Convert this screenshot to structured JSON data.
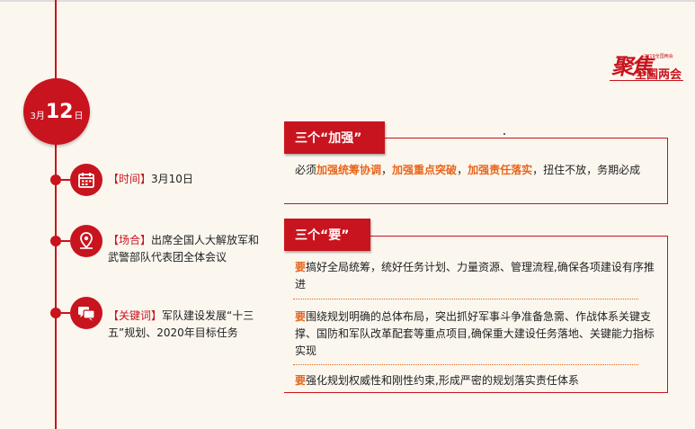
{
  "date": {
    "month": "3月",
    "day": "12",
    "suffix": "日"
  },
  "logo": {
    "big": "聚焦",
    "small": "2019全国两会",
    "year": "2019",
    "sub": "全国两会"
  },
  "info": {
    "time_label": "【时间】",
    "time_value": "3月10日",
    "place_label": "【场合】",
    "place_value": "出席全国人大解放军和武警部队代表团全体会议",
    "keyword_label": "【关键词】",
    "keyword_value": "军队建设发展“十三五”规划、2020年目标任务"
  },
  "section1": {
    "tag": "三个“加强”",
    "prefix": "必须",
    "h1": "加强统筹协调",
    "sep1": "，",
    "h2": "加强重点突破",
    "sep2": "，",
    "h3": "加强责任落实",
    "suffix": "，扭住不放，务期必成"
  },
  "section2": {
    "tag": "三个“要”",
    "items": [
      {
        "yao": "要",
        "text": "搞好全局统筹，统好任务计划、力量资源、管理流程,确保各项建设有序推进"
      },
      {
        "yao": "要",
        "text": "围绕规划明确的总体布局，突出抓好军事斗争准备急需、作战体系关键支撑、国防和军队改革配套等重点项目,确保重大建设任务落地、关键能力指标实现"
      },
      {
        "yao": "要",
        "text": "强化规划权威性和刚性约束,形成严密的规划落实责任体系"
      }
    ]
  },
  "colors": {
    "accent": "#c8141e",
    "highlight": "#e8661d",
    "background": "#fbf7ef"
  },
  "icons": {
    "time": "calendar-icon",
    "place": "location-pin-icon",
    "keyword": "chat-bubble-icon"
  }
}
